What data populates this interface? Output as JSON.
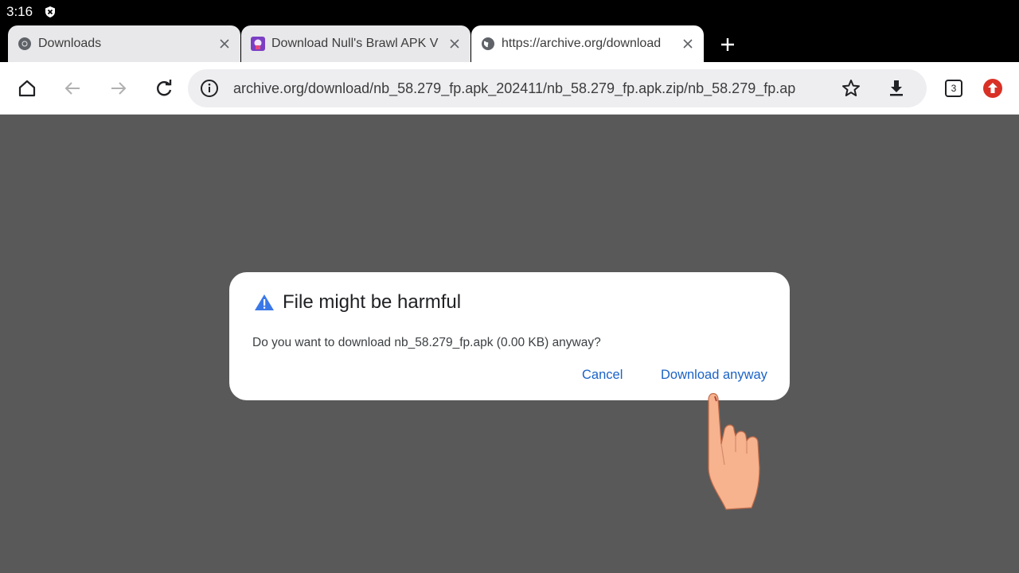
{
  "status_bar": {
    "time": "3:16",
    "shield_icon": "shield-x-icon"
  },
  "tabs": [
    {
      "title": "Downloads",
      "favicon": "chrome-icon",
      "active": false
    },
    {
      "title": "Download Null's Brawl APK V",
      "favicon": "nulls-brawl-icon",
      "active": false
    },
    {
      "title": "https://archive.org/download",
      "favicon": "globe-icon",
      "active": true
    }
  ],
  "toolbar": {
    "url": "archive.org/download/nb_58.279_fp.apk_202411/nb_58.279_fp.apk.zip/nb_58.279_fp.ap",
    "tab_count": "3"
  },
  "dialog": {
    "title": "File might be harmful",
    "message": "Do you want to download nb_58.279_fp.apk (0.00 KB) anyway?",
    "cancel_label": "Cancel",
    "confirm_label": "Download anyway",
    "accent_color": "#1a62c7",
    "warning_color": "#3b78e7"
  }
}
